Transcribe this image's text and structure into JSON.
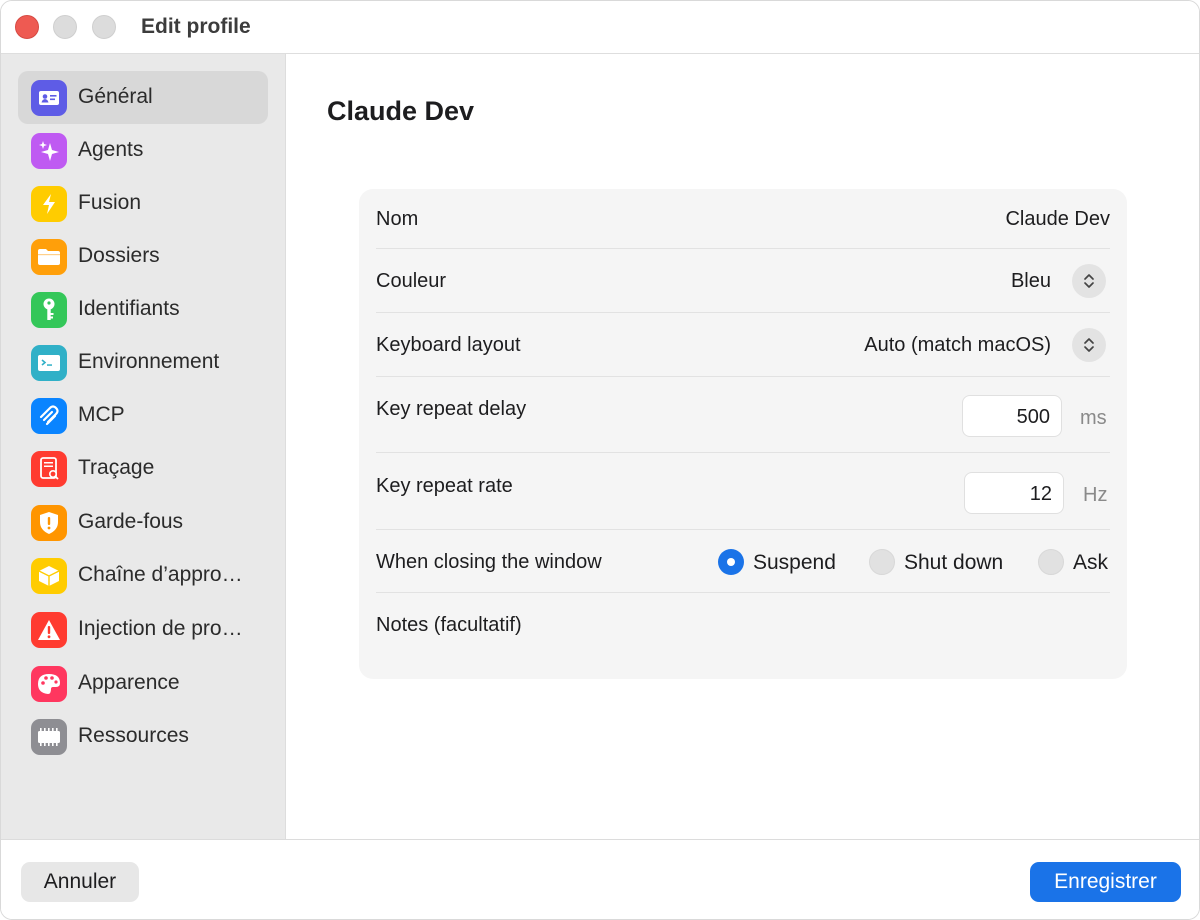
{
  "window": {
    "title": "Edit profile"
  },
  "sidebar": {
    "items": [
      {
        "label": "Général",
        "icon": "contact-card-icon",
        "color": "#5e5ce6",
        "selected": true
      },
      {
        "label": "Agents",
        "icon": "sparkles-icon",
        "color": "#bf5af2",
        "selected": false
      },
      {
        "label": "Fusion",
        "icon": "bolt-icon",
        "color": "#ffcc00",
        "selected": false
      },
      {
        "label": "Dossiers",
        "icon": "folder-icon",
        "color": "#ff9f0a",
        "selected": false
      },
      {
        "label": "Identifiants",
        "icon": "key-icon",
        "color": "#34c759",
        "selected": false
      },
      {
        "label": "Environnement",
        "icon": "terminal-icon",
        "color": "#30b0c7",
        "selected": false
      },
      {
        "label": "MCP",
        "icon": "mcp-icon",
        "color": "#0a84ff",
        "selected": false
      },
      {
        "label": "Traçage",
        "icon": "trace-document-icon",
        "color": "#ff3b30",
        "selected": false
      },
      {
        "label": "Garde-fous",
        "icon": "shield-alert-icon",
        "color": "#ff9500",
        "selected": false
      },
      {
        "label": "Chaîne d’appro…",
        "icon": "package-icon",
        "color": "#ffcc00",
        "selected": false
      },
      {
        "label": "Injection de pro…",
        "icon": "warning-triangle-icon",
        "color": "#ff3b30",
        "selected": false
      },
      {
        "label": "Apparence",
        "icon": "palette-icon",
        "color": "#ff375f",
        "selected": false
      },
      {
        "label": "Ressources",
        "icon": "memory-chip-icon",
        "color": "#8e8e93",
        "selected": false
      }
    ]
  },
  "main": {
    "title": "Claude Dev",
    "fields": {
      "name": {
        "label": "Nom",
        "value": "Claude Dev"
      },
      "color": {
        "label": "Couleur",
        "value": "Bleu"
      },
      "keyboard": {
        "label": "Keyboard layout",
        "value": "Auto (match macOS)"
      },
      "repeat_delay": {
        "label": "Key repeat delay",
        "value": "500",
        "unit": "ms"
      },
      "repeat_rate": {
        "label": "Key repeat rate",
        "value": "12",
        "unit": "Hz"
      },
      "closing": {
        "label": "When closing the window",
        "options": [
          "Suspend",
          "Shut down",
          "Ask"
        ],
        "selected": "Suspend"
      },
      "notes": {
        "label": "Notes (facultatif)",
        "value": ""
      }
    }
  },
  "footer": {
    "cancel_label": "Annuler",
    "save_label": "Enregistrer"
  },
  "colors": {
    "accent": "#1a73e8",
    "close_button": "#ee5a52",
    "sidebar_bg": "#e9e9e9"
  }
}
